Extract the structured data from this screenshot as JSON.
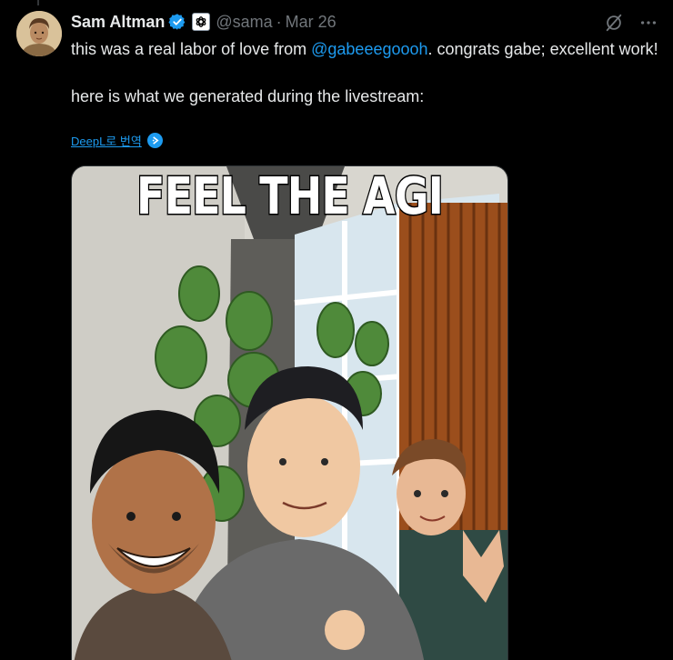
{
  "author": {
    "display_name": "Sam Altman",
    "handle": "@sama",
    "separator": "·",
    "date": "Mar 26",
    "verified_icon": "verified-badge-icon",
    "affiliation_icon": "openai-logo-icon"
  },
  "actions": {
    "grok_icon": "grok-icon",
    "more_icon": "more-icon",
    "more_label": "···"
  },
  "body": {
    "line1_before": "this was a real labor of love from ",
    "mention": "@gabeeegoooh",
    "line1_after": ". congrats gabe; excellent work!",
    "line2": "here is what we generated during the livestream:"
  },
  "translate": {
    "label": "DeepL로 번역"
  },
  "media": {
    "caption_text": "FEEL THE AGI"
  },
  "colors": {
    "background": "#000000",
    "text": "#e7e9ea",
    "secondary": "#71767b",
    "accent": "#1d9bf0"
  }
}
